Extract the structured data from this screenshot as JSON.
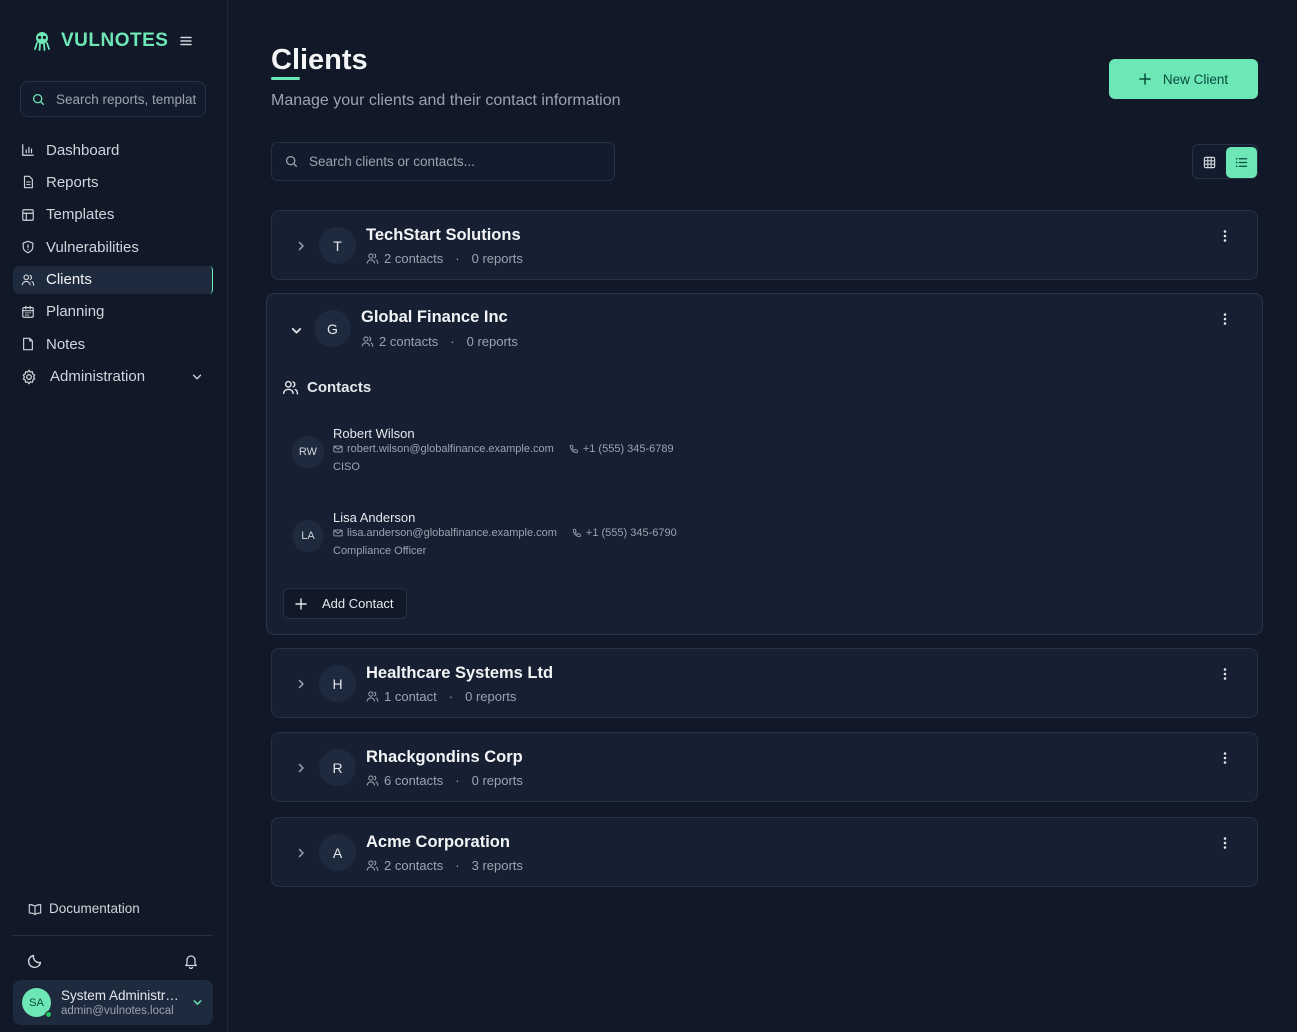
{
  "app": {
    "name": "VULNOTES"
  },
  "sidebar": {
    "search_placeholder": "Search reports, templates...",
    "items": [
      {
        "label": "Dashboard",
        "icon": "bar-chart-icon"
      },
      {
        "label": "Reports",
        "icon": "file-icon"
      },
      {
        "label": "Templates",
        "icon": "layout-icon"
      },
      {
        "label": "Vulnerabilities",
        "icon": "shield-icon"
      },
      {
        "label": "Clients",
        "icon": "users-icon",
        "active": true
      },
      {
        "label": "Planning",
        "icon": "calendar-icon"
      },
      {
        "label": "Notes",
        "icon": "note-icon"
      },
      {
        "label": "Administration",
        "icon": "gear-icon"
      }
    ],
    "documentation": "Documentation",
    "user": {
      "initials": "SA",
      "name": "System Administrator",
      "email": "admin@vulnotes.local"
    }
  },
  "header": {
    "title": "Clients",
    "subtitle": "Manage your clients and their contact information",
    "new_button": "New Client",
    "search_placeholder": "Search clients or contacts..."
  },
  "clients": [
    {
      "initial": "T",
      "name": "TechStart Solutions",
      "contacts": "2 contacts",
      "reports": "0 reports"
    },
    {
      "initial": "G",
      "name": "Global Finance Inc",
      "contacts": "2 contacts",
      "reports": "0 reports",
      "expanded": true,
      "contacts_heading": "Contacts",
      "contact_list": [
        {
          "initials": "RW",
          "name": "Robert Wilson",
          "email": "robert.wilson@globalfinance.example.com",
          "phone": "+1 (555) 345-6789",
          "role": "CISO"
        },
        {
          "initials": "LA",
          "name": "Lisa Anderson",
          "email": "lisa.anderson@globalfinance.example.com",
          "phone": "+1 (555) 345-6790",
          "role": "Compliance Officer"
        }
      ],
      "add_contact": "Add Contact"
    },
    {
      "initial": "H",
      "name": "Healthcare Systems Ltd",
      "contacts": "1 contact",
      "reports": "0 reports"
    },
    {
      "initial": "R",
      "name": "Rhackgondins Corp",
      "contacts": "6 contacts",
      "reports": "0 reports"
    },
    {
      "initial": "A",
      "name": "Acme Corporation",
      "contacts": "2 contacts",
      "reports": "3 reports"
    }
  ],
  "separator": "·",
  "colors": {
    "accent": "#6ee7b7",
    "background": "#111827",
    "card": "#162032"
  }
}
